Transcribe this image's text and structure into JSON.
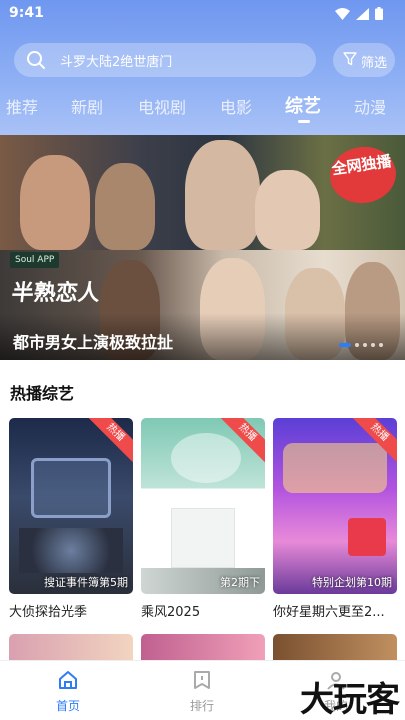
{
  "status_bar": {
    "time": "9:41"
  },
  "search": {
    "placeholder": "斗罗大陆2绝世唐门"
  },
  "filter": {
    "label": "筛选"
  },
  "tabs": [
    {
      "label": "推荐"
    },
    {
      "label": "新剧"
    },
    {
      "label": "电视剧"
    },
    {
      "label": "电影"
    },
    {
      "label": "综艺",
      "active": true
    },
    {
      "label": "动漫"
    }
  ],
  "banner": {
    "badge": "全网独播",
    "soul_tag": "Soul APP",
    "show_logo": "半熟恋人",
    "caption": "都市男女上演极致拉扯",
    "dots_count": 5,
    "active_dot": 0
  },
  "section": {
    "title": "热播综艺"
  },
  "cards": [
    {
      "title": "大侦探拾光季",
      "episode": "搜证事件簿第5期",
      "ribbon": "热播"
    },
    {
      "title": "乘风2025",
      "episode": "第2期下",
      "ribbon": "热播"
    },
    {
      "title": "你好星期六更至2...",
      "episode": "特别企划第10期",
      "ribbon": "热播"
    }
  ],
  "bottom_nav": [
    {
      "label": "首页",
      "active": true
    },
    {
      "label": "排行"
    },
    {
      "label": "我的"
    }
  ],
  "watermark": "大玩客",
  "colors": {
    "accent": "#2f7df6",
    "ribbon": "#ef4b4b",
    "header_start": "#6f97f0",
    "header_end": "#a9c2f7"
  }
}
